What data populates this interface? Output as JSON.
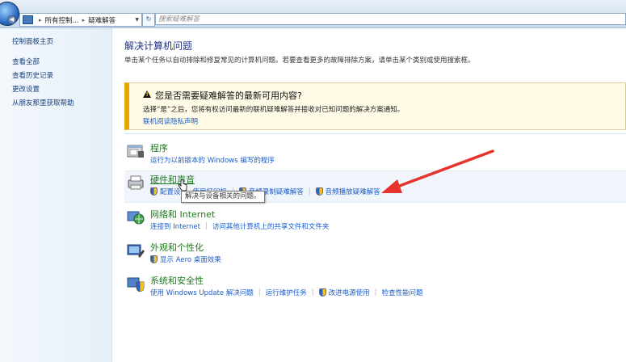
{
  "addressbar": {
    "crumbs": [
      "所有控制...",
      "疑难解答"
    ],
    "search_placeholder": "搜索疑难解答"
  },
  "leftnav": {
    "home": "控制面板主页",
    "items": [
      "查看全部",
      "查看历史记录",
      "更改设置",
      "从朋友那里获取帮助"
    ]
  },
  "main": {
    "title": "解决计算机问题",
    "subtitle": "单击某个任务以自动排除和修复常见的计算机问题。若要查看更多的故障排除方案，请单击某个类别或使用搜索框。",
    "banner": {
      "title": "您是否需要疑难解答的最新可用内容?",
      "text": "选择“是”之后，您将有权访问最新的联机疑难解答并接收对已知问题的解决方案通知。",
      "link": "联机阅读隐私声明"
    },
    "categories": [
      {
        "title": "程序",
        "links": [
          "运行为以前版本的 Windows 编写的程序"
        ]
      },
      {
        "title": "硬件和声音",
        "links": [
          "配置设",
          "使用打印机",
          "音频录制疑难解答",
          "音频播放疑难解答"
        ]
      },
      {
        "title": "网络和 Internet",
        "links": [
          "连接到 Internet",
          "访问其他计算机上的共享文件和文件夹"
        ]
      },
      {
        "title": "外观和个性化",
        "links": [
          "显示 Aero 桌面效果"
        ]
      },
      {
        "title": "系统和安全性",
        "links": [
          "使用 Windows Update 解决问题",
          "运行维护任务",
          "改进电源使用",
          "检查性能问题"
        ]
      }
    ],
    "tooltip": "解决与设备相关的问题。"
  },
  "colors": {
    "category_title": "#1e7a1e",
    "link": "#1a5ccc",
    "banner_accent": "#e6a800",
    "annotation_arrow": "#e8322c"
  }
}
